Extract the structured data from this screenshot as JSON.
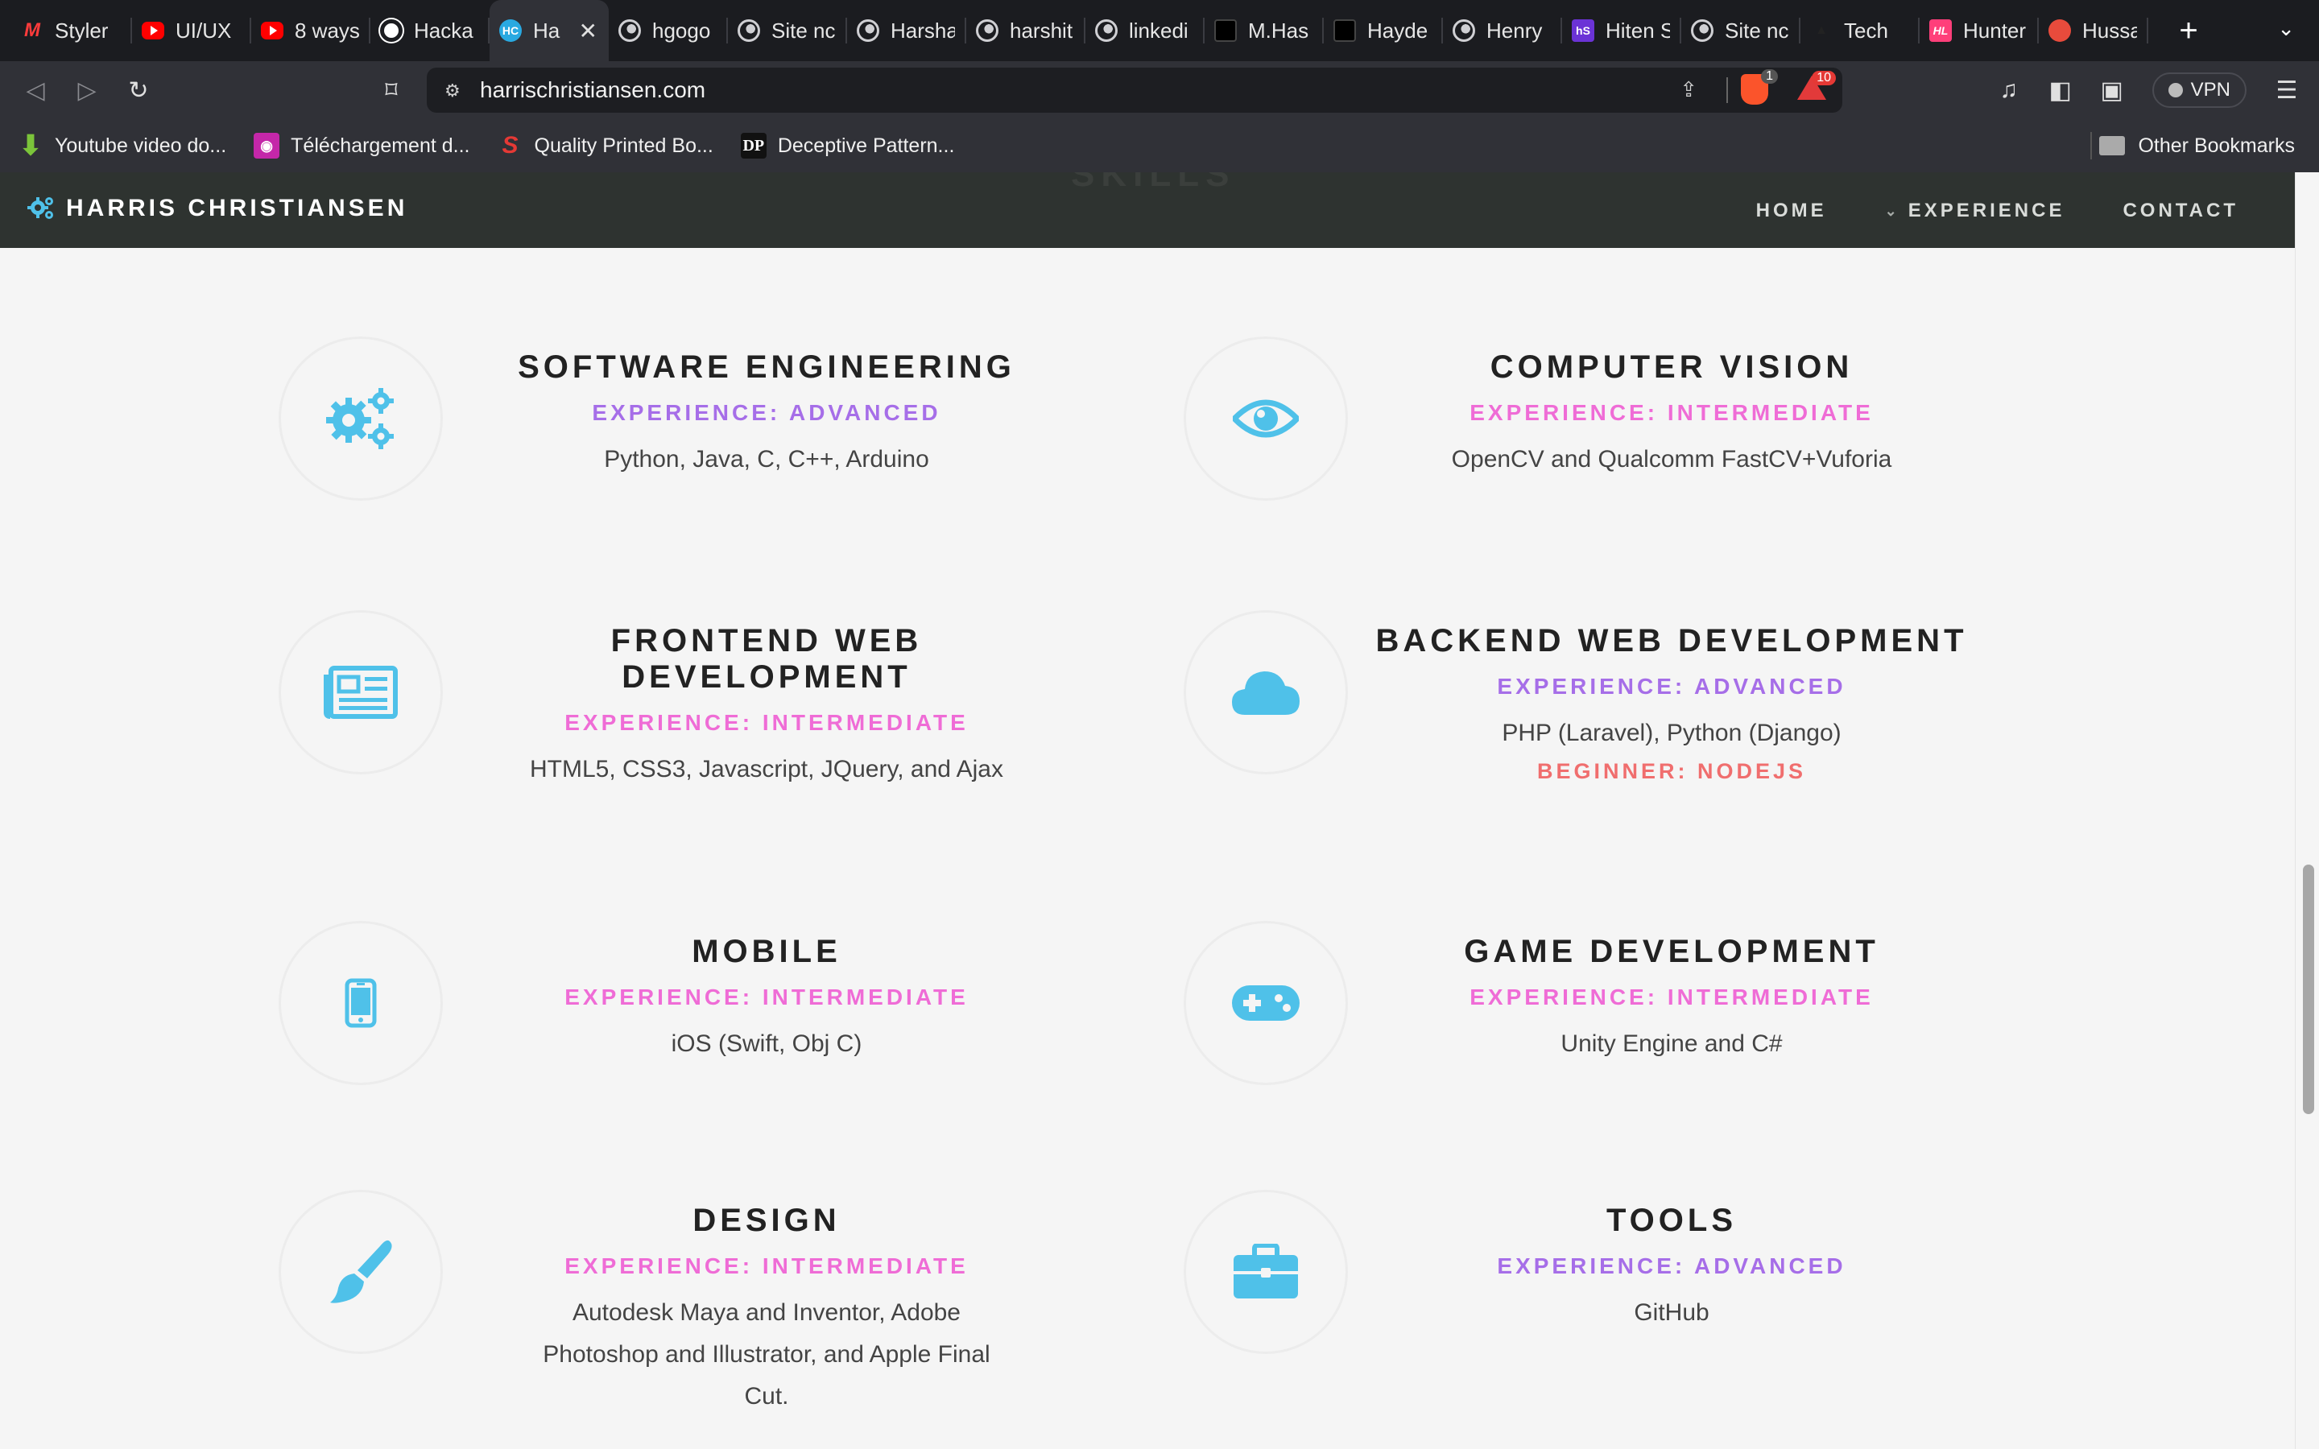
{
  "browser": {
    "tabs": [
      {
        "title": "Styler",
        "icon": "m-logo-icon"
      },
      {
        "title": "UI/UX",
        "icon": "youtube-icon"
      },
      {
        "title": "8 ways",
        "icon": "youtube-icon"
      },
      {
        "title": "Hacka",
        "icon": "github-icon"
      },
      {
        "title": "Ha",
        "icon": "hc-icon",
        "active": true
      },
      {
        "title": "hgogo",
        "icon": "globe-icon"
      },
      {
        "title": "Site nc",
        "icon": "globe-icon"
      },
      {
        "title": "Harsha",
        "icon": "globe-icon"
      },
      {
        "title": "harshit",
        "icon": "globe-icon"
      },
      {
        "title": "linkedi",
        "icon": "globe-icon"
      },
      {
        "title": "M.Has",
        "icon": "dark-square-icon"
      },
      {
        "title": "Hayde",
        "icon": "dark-square-icon"
      },
      {
        "title": "Henry",
        "icon": "globe-icon"
      },
      {
        "title": "Hiten S",
        "icon": "hs-icon"
      },
      {
        "title": "Site nc",
        "icon": "globe-icon"
      },
      {
        "title": "Tech",
        "icon": "triangle-icon"
      },
      {
        "title": "Hunter",
        "icon": "hu-icon"
      },
      {
        "title": "Hussa",
        "icon": "mushroom-icon"
      }
    ],
    "url": "harrischristiansen.com",
    "shield_badge": "1",
    "rewards_badge": "10",
    "vpn_label": "VPN",
    "bookmarks": [
      {
        "label": "Youtube video do...",
        "icon": "download-arrow-icon"
      },
      {
        "label": "Téléchargement d...",
        "icon": "telechargement-icon"
      },
      {
        "label": "Quality Printed Bo...",
        "icon": "s-logo-icon"
      },
      {
        "label": "Deceptive Pattern...",
        "icon": "dp-logo-icon"
      }
    ],
    "other_bookmarks": "Other Bookmarks"
  },
  "site": {
    "brand": "HARRIS CHRISTIANSEN",
    "section_peek": "SKILLS",
    "nav": {
      "home": "HOME",
      "experience": "EXPERIENCE",
      "contact": "CONTACT"
    },
    "skills": [
      {
        "title": "SOFTWARE ENGINEERING",
        "level": "EXPERIENCE: ADVANCED",
        "level_kind": "advanced",
        "desc": "Python, Java, C, C++, Arduino",
        "icon": "gears-icon"
      },
      {
        "title": "COMPUTER VISION",
        "level": "EXPERIENCE: INTERMEDIATE",
        "level_kind": "intermediate",
        "desc": "OpenCV and Qualcomm FastCV+Vuforia",
        "icon": "eye-icon"
      },
      {
        "title": "FRONTEND WEB DEVELOPMENT",
        "level": "EXPERIENCE: INTERMEDIATE",
        "level_kind": "intermediate",
        "desc": "HTML5, CSS3, Javascript, JQuery, and Ajax",
        "icon": "newspaper-icon"
      },
      {
        "title": "BACKEND WEB DEVELOPMENT",
        "level": "EXPERIENCE: ADVANCED",
        "level_kind": "advanced",
        "desc": "PHP (Laravel), Python (Django)",
        "extra": "BEGINNER: NODEJS",
        "icon": "cloud-icon"
      },
      {
        "title": "MOBILE",
        "level": "EXPERIENCE: INTERMEDIATE",
        "level_kind": "intermediate",
        "desc": "iOS (Swift, Obj C)",
        "icon": "phone-icon"
      },
      {
        "title": "GAME DEVELOPMENT",
        "level": "EXPERIENCE: INTERMEDIATE",
        "level_kind": "intermediate",
        "desc": "Unity Engine and C#",
        "icon": "gamepad-icon"
      },
      {
        "title": "DESIGN",
        "level": "EXPERIENCE: INTERMEDIATE",
        "level_kind": "intermediate",
        "desc": "Autodesk Maya and Inventor, Adobe Photoshop and Illustrator, and Apple Final Cut.",
        "icon": "paintbrush-icon"
      },
      {
        "title": "TOOLS",
        "level": "EXPERIENCE: ADVANCED",
        "level_kind": "advanced",
        "desc": "GitHub",
        "icon": "briefcase-icon"
      }
    ]
  },
  "colors": {
    "accent_icon": "#4fc1e9",
    "advanced": "#a66ee8",
    "intermediate": "#ef6cd6",
    "beginner": "#f06e6e",
    "nav_bg": "#2e3330"
  }
}
